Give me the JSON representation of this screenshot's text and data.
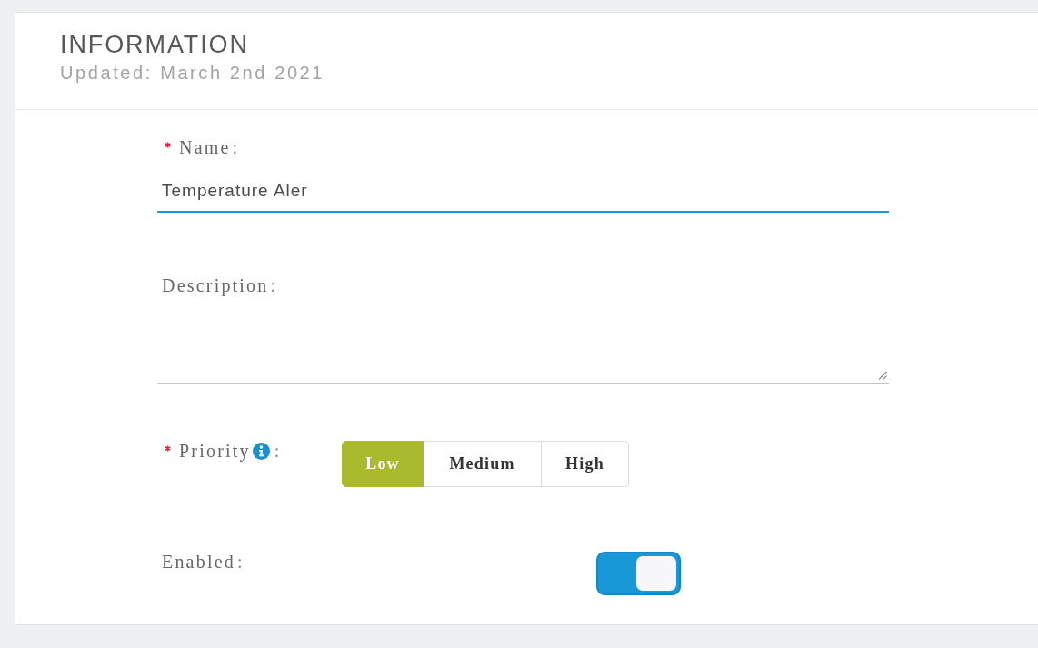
{
  "header": {
    "title": "INFORMATION",
    "subtitle": "Updated: March 2nd 2021"
  },
  "form": {
    "fields": [
      {
        "kind": "text",
        "label": "Name",
        "colon": ":",
        "required": true,
        "info": false,
        "value": "Temperature Aler",
        "focused": true
      },
      {
        "kind": "textarea",
        "label": "Description",
        "colon": ":",
        "required": false,
        "info": false
      },
      {
        "kind": "segmented",
        "label": "Priority",
        "colon": ":",
        "required": true,
        "info": true,
        "options": [
          {
            "label": "Low",
            "selected": true
          },
          {
            "label": "Medium",
            "selected": false
          },
          {
            "label": "High",
            "selected": false
          }
        ]
      },
      {
        "kind": "toggle",
        "label": "Enabled",
        "colon": ":",
        "required": false,
        "info": false,
        "on": true
      }
    ]
  }
}
